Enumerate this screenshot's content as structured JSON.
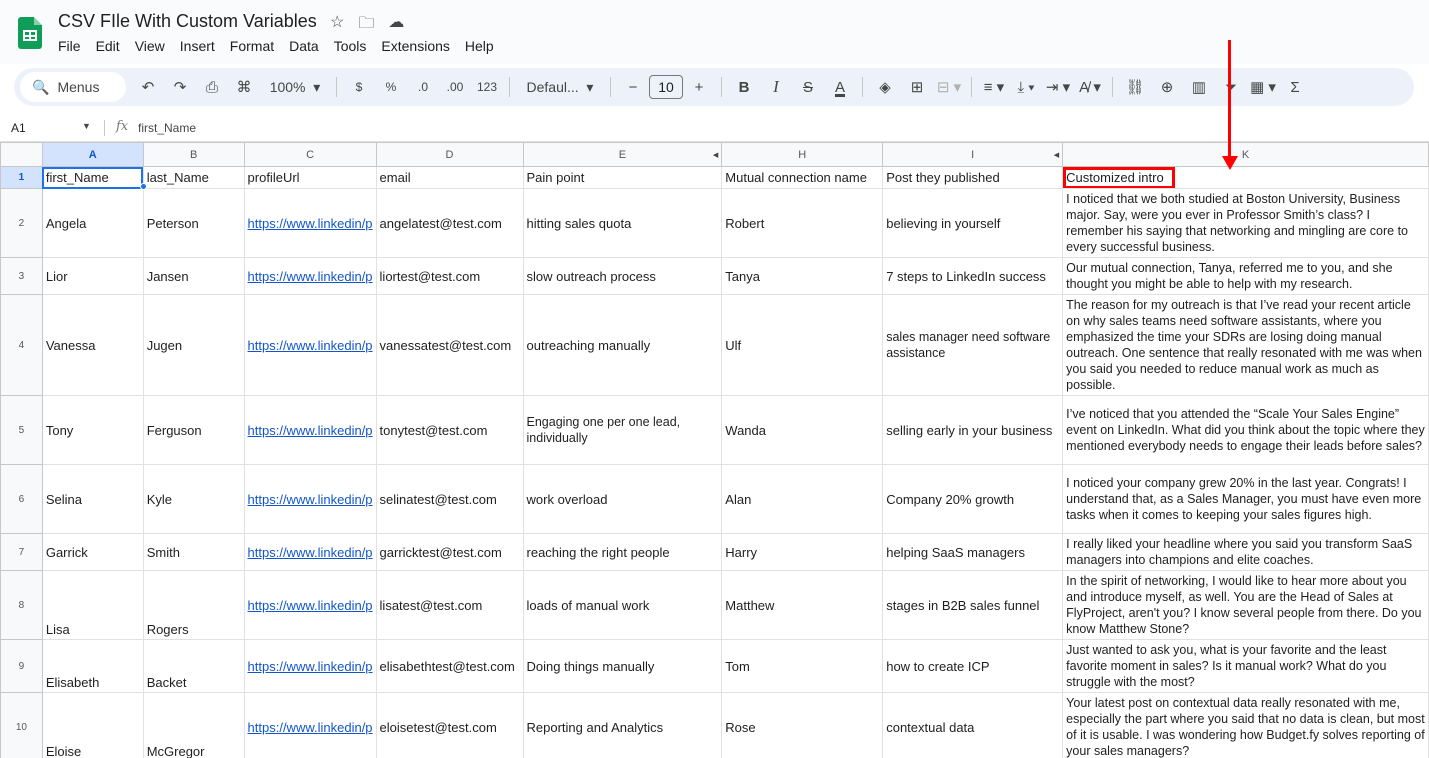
{
  "app": {
    "doc_title": "CSV FIle With Custom Variables",
    "menu": [
      "File",
      "Edit",
      "View",
      "Insert",
      "Format",
      "Data",
      "Tools",
      "Extensions",
      "Help"
    ]
  },
  "toolbar": {
    "search_label": "Menus",
    "zoom": "100%",
    "currency": "$",
    "percent": "%",
    "dec_decrease": ".0",
    "dec_increase": ".00",
    "number_format": "123",
    "font": "Defaul...",
    "font_size": "10",
    "bold": "B",
    "italic": "I",
    "text_color": "A"
  },
  "formula_bar": {
    "cell_ref": "A1",
    "fx": "fx",
    "formula": "first_Name"
  },
  "columns": [
    "A",
    "B",
    "C",
    "D",
    "E",
    "",
    "H",
    "I",
    "",
    "K"
  ],
  "rows": [
    {
      "num": "1",
      "cells": [
        "first_Name",
        "last_Name",
        "profileUrl",
        "email",
        "Pain point",
        "Mutual connection name",
        "Post they published",
        "Customized intro"
      ]
    },
    {
      "num": "2",
      "cells": [
        "Angela",
        "Peterson",
        "https://www.linkedin/p",
        "angelatest@test.com",
        "hitting sales quota",
        "Robert",
        "believing in yourself",
        "I noticed that we both studied at Boston University, Business major. Say, were you ever in Professor Smith’s class? I remember his saying that networking and mingling are core to every successful business."
      ]
    },
    {
      "num": "3",
      "cells": [
        "Lior",
        "Jansen",
        "https://www.linkedin/p",
        "liortest@test.com",
        "slow outreach process",
        "Tanya",
        "7 steps to LinkedIn success",
        "Our mutual connection, Tanya, referred me to you, and she thought you might be able to help with my research."
      ]
    },
    {
      "num": "4",
      "cells": [
        "Vanessa",
        "Jugen",
        "https://www.linkedin/p",
        "vanessatest@test.com",
        "outreaching manually",
        "Ulf",
        "sales manager need software assistance",
        "The reason for my outreach is that I’ve read your recent article on why sales teams need software assistants, where you emphasized the time your SDRs are losing doing manual outreach. One sentence that really resonated with me was when you said you needed to reduce manual work as much as possible."
      ]
    },
    {
      "num": "5",
      "cells": [
        "Tony",
        "Ferguson",
        "https://www.linkedin/p",
        "tonytest@test.com",
        "Engaging one per one lead, individually",
        "Wanda",
        "selling early in your business",
        "I’ve noticed that you attended the “Scale Your Sales Engine” event on LinkedIn. What did you think about the topic where they mentioned everybody needs to engage their leads before sales?"
      ]
    },
    {
      "num": "6",
      "cells": [
        "Selina",
        "Kyle",
        "https://www.linkedin/p",
        "selinatest@test.com",
        "work overload",
        "Alan",
        "Company 20% growth",
        "I noticed your company grew 20% in the last year. Congrats! I understand that, as a Sales Manager, you must have even more tasks when it comes to keeping your sales figures high."
      ]
    },
    {
      "num": "7",
      "cells": [
        "Garrick",
        "Smith",
        "https://www.linkedin/p",
        "garricktest@test.com",
        "reaching the right people",
        "Harry",
        "helping SaaS managers",
        "I really liked your headline where you said you transform SaaS managers into champions and elite coaches."
      ]
    },
    {
      "num": "8",
      "cells": [
        "Lisa",
        "Rogers",
        "https://www.linkedin/p",
        "lisatest@test.com",
        "loads of manual work",
        "Matthew",
        "stages in B2B sales funnel",
        "In the spirit of networking, I would like to hear more about you and introduce myself, as well. You are the Head of Sales at FlyProject, aren't you? I know several people from there. Do you know Matthew Stone?"
      ]
    },
    {
      "num": "9",
      "cells": [
        "Elisabeth",
        "Backet",
        "https://www.linkedin/p",
        "elisabethtest@test.com",
        "Doing things manually",
        "Tom",
        "how to create ICP",
        "Just wanted to ask you, what is your favorite and the least favorite moment in sales? Is it manual work? What do you struggle with the most?"
      ]
    },
    {
      "num": "10",
      "cells": [
        "Eloise",
        "McGregor",
        "https://www.linkedin/p",
        "eloisetest@test.com",
        "Reporting and Analytics",
        "Rose",
        "contextual data",
        "Your latest post on contextual data really resonated with me, especially the part where you said that no data is clean, but most of it is usable. I was wondering how Budget.fy solves reporting of your sales managers?"
      ]
    }
  ],
  "annotation_color": "#ff0000"
}
